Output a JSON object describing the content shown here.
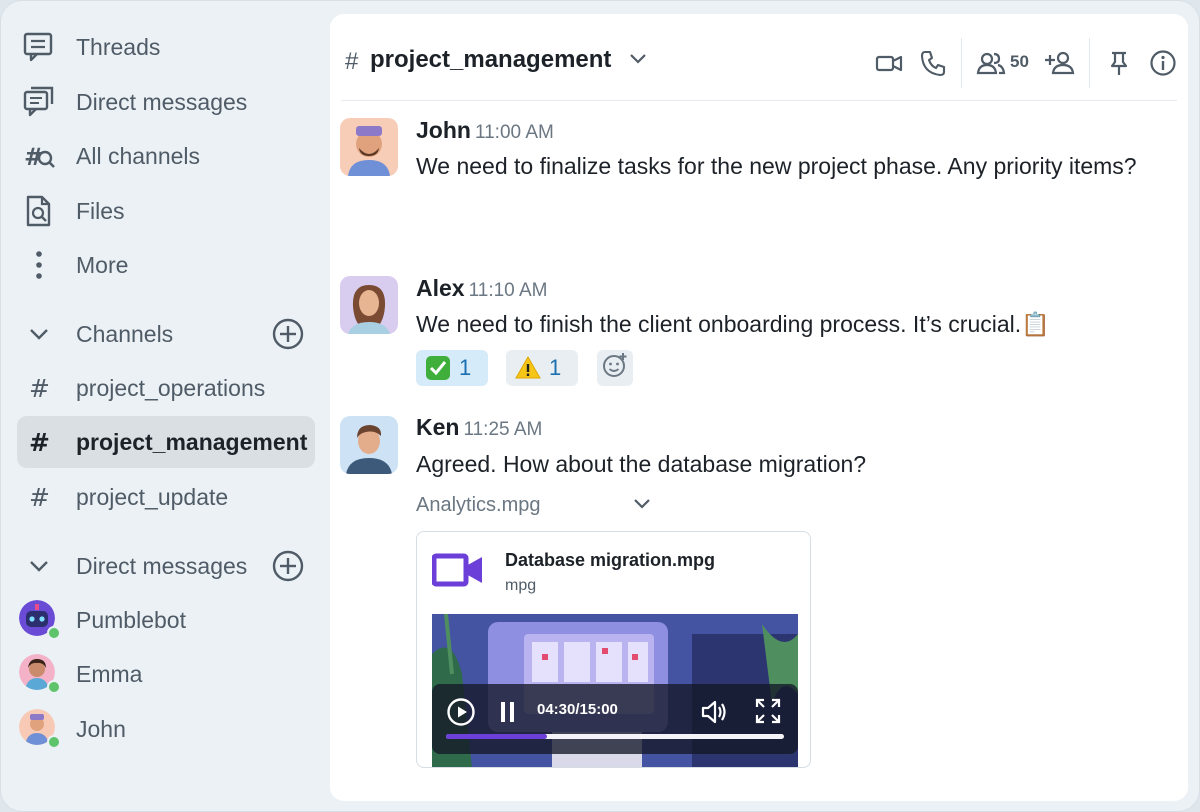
{
  "sidebar": {
    "nav": [
      {
        "label": "Threads",
        "icon": "threads-icon"
      },
      {
        "label": "Direct messages",
        "icon": "direct-messages-icon"
      },
      {
        "label": "All channels",
        "icon": "all-channels-icon"
      },
      {
        "label": "Files",
        "icon": "files-icon"
      },
      {
        "label": "More",
        "icon": "more-icon"
      }
    ],
    "channels_header": "Channels",
    "channels": [
      {
        "label": "project_operations",
        "active": false
      },
      {
        "label": "project_management",
        "active": true
      },
      {
        "label": "project_update",
        "active": false
      }
    ],
    "dm_header": "Direct messages",
    "dms": [
      {
        "label": "Pumblebot",
        "status": "online"
      },
      {
        "label": "Emma",
        "status": "online"
      },
      {
        "label": "John",
        "status": "online"
      }
    ]
  },
  "channel": {
    "hash": "#",
    "name": "project_management",
    "member_count": "50"
  },
  "messages": [
    {
      "name": "John",
      "time": "11:00 AM",
      "text": "We need to finalize tasks for the new project phase. Any priority items?"
    },
    {
      "name": "Alex",
      "time": "11:10 AM",
      "text": "We need to finish the client onboarding process. It’s crucial.📋"
    },
    {
      "name": "Ken",
      "time": "11:25 AM",
      "text": "Agreed. How about the database migration?"
    }
  ],
  "reactions": [
    {
      "emoji": "✅",
      "count": "1"
    },
    {
      "emoji": "⚠️",
      "count": "1"
    }
  ],
  "attachment": {
    "group_name": "Analytics.mpg",
    "file_name": "Database migration.mpg",
    "file_type": "mpg",
    "time": "04:30/15:00",
    "progress": 0.3
  },
  "colors": {
    "accent": "#6b3fd8",
    "active_bg": "#dadfe4",
    "online": "#5ec36a",
    "reaction_active": "#d6ebf9"
  }
}
